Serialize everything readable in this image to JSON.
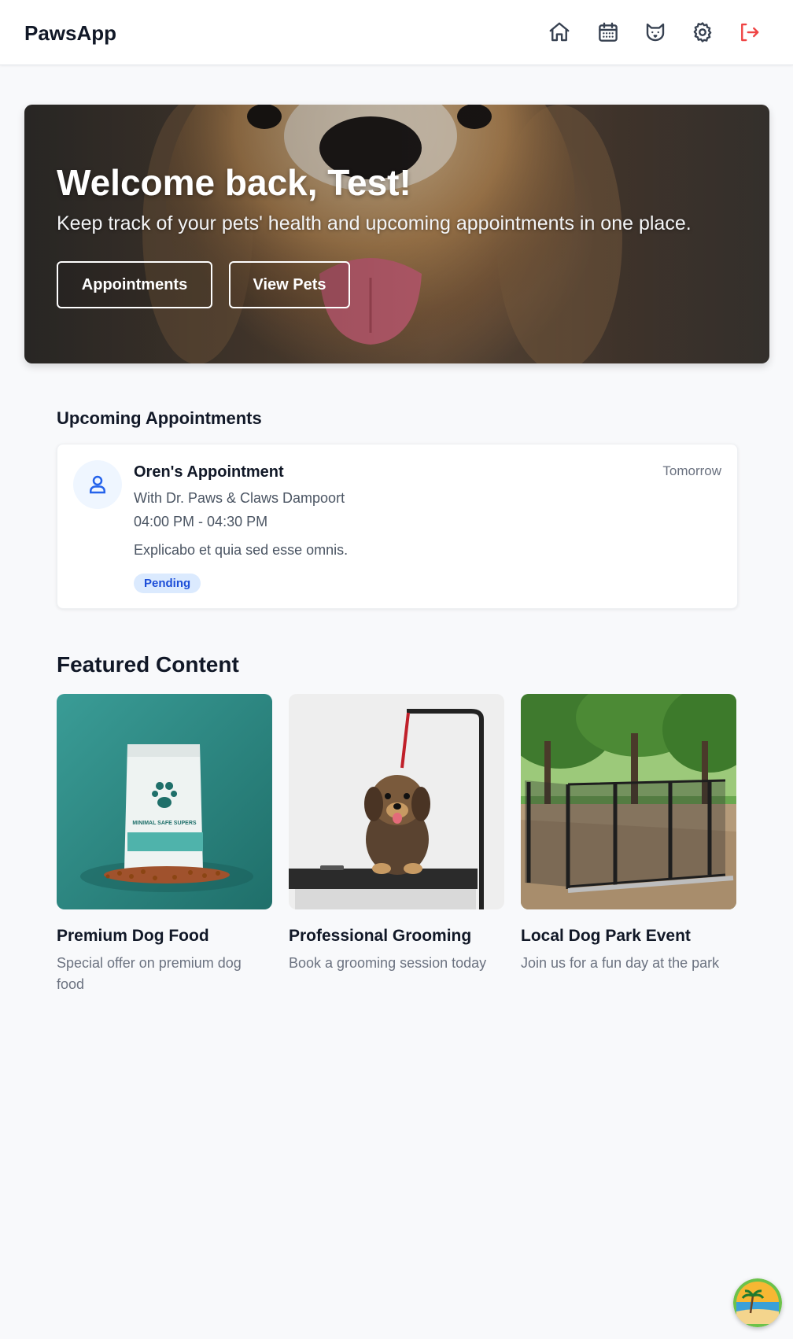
{
  "header": {
    "brand": "PawsApp",
    "nav": [
      {
        "icon": "home-icon"
      },
      {
        "icon": "calendar-icon"
      },
      {
        "icon": "cat-icon"
      },
      {
        "icon": "settings-icon"
      },
      {
        "icon": "logout-icon"
      }
    ]
  },
  "hero": {
    "title": "Welcome back, Test!",
    "subtitle": "Keep track of your pets' health and upcoming appointments in one place.",
    "buttons": {
      "appointments": "Appointments",
      "view_pets": "View Pets"
    }
  },
  "upcoming": {
    "title": "Upcoming Appointments",
    "appointments": [
      {
        "title": "Oren's Appointment",
        "with": "With Dr. Paws & Claws Dampoort",
        "time": "04:00 PM - 04:30 PM",
        "note": "Explicabo et quia sed esse omnis.",
        "when": "Tomorrow",
        "status": "Pending"
      }
    ]
  },
  "featured": {
    "title": "Featured Content",
    "items": [
      {
        "title": "Premium Dog Food",
        "description": "Special offer on premium dog food",
        "image": "dog-food-bag-image",
        "bag_text": "MINIMAL SAFE SUPERS"
      },
      {
        "title": "Professional Grooming",
        "description": "Book a grooming session today",
        "image": "grooming-dog-image"
      },
      {
        "title": "Local Dog Park Event",
        "description": "Join us for a fun day at the park",
        "image": "dog-park-image"
      }
    ]
  },
  "colors": {
    "accent": "#2563eb",
    "logout": "#ef4444",
    "badge_bg": "#dbeafe",
    "badge_text": "#1d4ed8"
  }
}
